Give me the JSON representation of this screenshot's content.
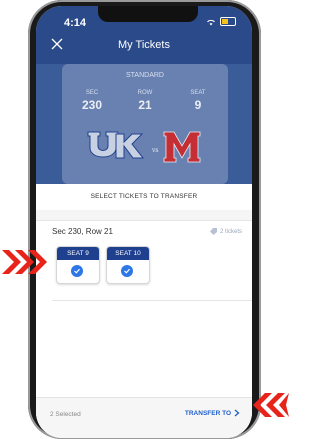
{
  "status": {
    "time": "4:14"
  },
  "header": {
    "title": "My Tickets"
  },
  "ticket": {
    "tier": "STANDARD",
    "sec_label": "SEC",
    "sec_value": "230",
    "row_label": "ROW",
    "row_value": "21",
    "seat_label": "SEAT",
    "seat_value": "9"
  },
  "sheet": {
    "title": "SELECT TICKETS TO TRANSFER",
    "section_row": "Sec 230, Row 21",
    "ticket_count": "2 tickets",
    "seats": [
      {
        "label": "SEAT 9",
        "checked": true
      },
      {
        "label": "SEAT 10",
        "checked": true
      }
    ]
  },
  "footer": {
    "selected": "2 Selected",
    "transfer_label": "TRANSFER TO"
  },
  "colors": {
    "header_bg": "#2a4a8a",
    "seat_header": "#1f3f8f",
    "check": "#2d78e6",
    "transfer": "#1f5fcc",
    "arrows": "#e8231a"
  },
  "icons": [
    "close-icon",
    "wifi-icon",
    "battery-icon",
    "tag-icon",
    "check-icon",
    "chevron-right-icon",
    "arrow-right-icon",
    "arrow-left-icon"
  ]
}
